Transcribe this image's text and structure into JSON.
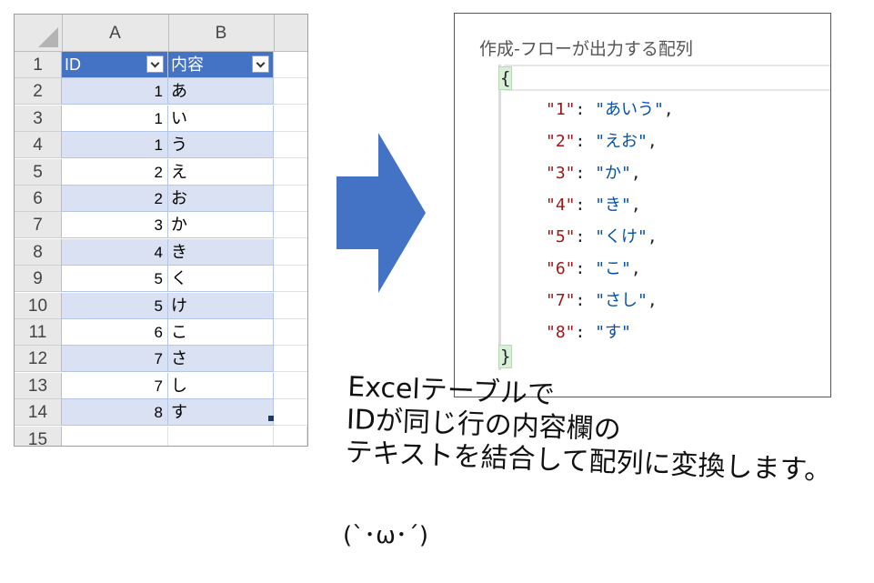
{
  "sheet": {
    "columns": [
      "A",
      "B"
    ],
    "header": {
      "row_num": "1",
      "id": "ID",
      "content": "内容"
    },
    "rows": [
      {
        "num": "2",
        "id": "1",
        "text": "あ"
      },
      {
        "num": "3",
        "id": "1",
        "text": "い"
      },
      {
        "num": "4",
        "id": "1",
        "text": "う"
      },
      {
        "num": "5",
        "id": "2",
        "text": "え"
      },
      {
        "num": "6",
        "id": "2",
        "text": "お"
      },
      {
        "num": "7",
        "id": "3",
        "text": "か"
      },
      {
        "num": "8",
        "id": "4",
        "text": "き"
      },
      {
        "num": "9",
        "id": "5",
        "text": "く"
      },
      {
        "num": "10",
        "id": "5",
        "text": "け"
      },
      {
        "num": "11",
        "id": "6",
        "text": "こ"
      },
      {
        "num": "12",
        "id": "7",
        "text": "さ"
      },
      {
        "num": "13",
        "id": "7",
        "text": "し"
      },
      {
        "num": "14",
        "id": "8",
        "text": "す"
      }
    ],
    "empty_row_num": "15",
    "colors": {
      "header_fill": "#4472c4",
      "band_fill": "#d9e1f2"
    }
  },
  "arrow": {
    "color": "#4472c4"
  },
  "panel": {
    "title": "作成-フローが出力する配列",
    "open_brace": "{",
    "close_brace": "}",
    "entries": [
      {
        "key": "\"1\"",
        "value": "\"あいう\"",
        "comma": ","
      },
      {
        "key": "\"2\"",
        "value": "\"えお\"",
        "comma": ","
      },
      {
        "key": "\"3\"",
        "value": "\"か\"",
        "comma": ","
      },
      {
        "key": "\"4\"",
        "value": "\"き\"",
        "comma": ","
      },
      {
        "key": "\"5\"",
        "value": "\"くけ\"",
        "comma": ","
      },
      {
        "key": "\"6\"",
        "value": "\"こ\"",
        "comma": ","
      },
      {
        "key": "\"7\"",
        "value": "\"さし\"",
        "comma": ","
      },
      {
        "key": "\"8\"",
        "value": "\"す\"",
        "comma": ""
      }
    ],
    "colors": {
      "key": "#a31515",
      "value": "#0451a5"
    }
  },
  "caption": {
    "lines": [
      "Excelテーブルで",
      "IDが同じ行の内容欄の",
      "テキストを結合して配列に変換します。"
    ],
    "kaomoji": "(`･ω･´)"
  }
}
